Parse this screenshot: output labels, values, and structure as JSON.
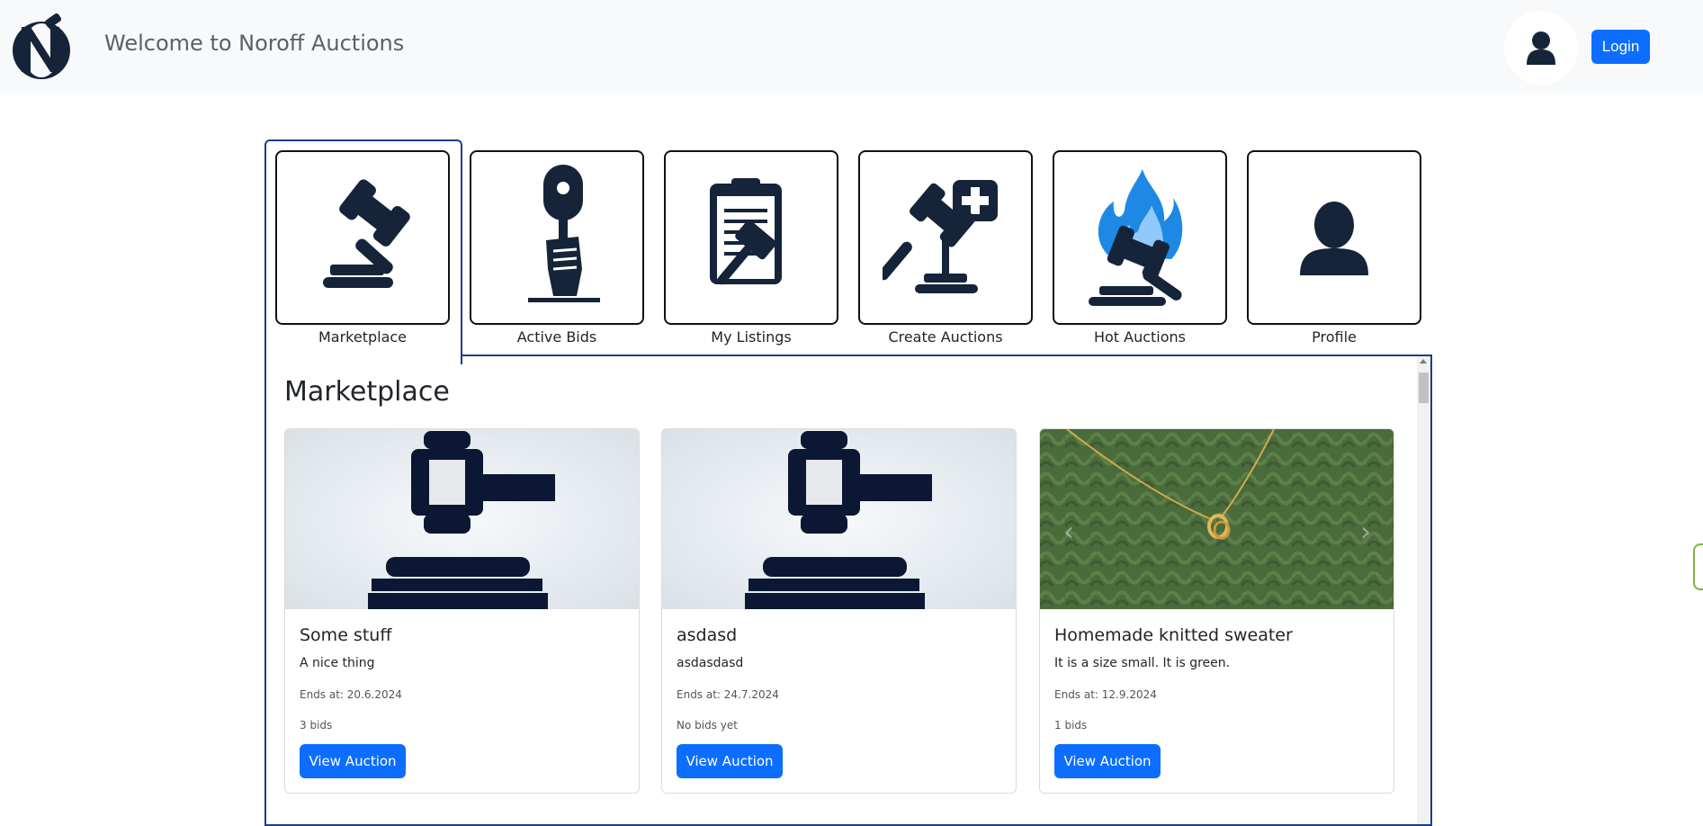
{
  "header": {
    "title": "Welcome to Noroff Auctions",
    "login_label": "Login",
    "logo_icon": "noroff-logo-icon",
    "avatar_icon": "user-icon"
  },
  "tabs": [
    {
      "label": "Marketplace",
      "icon": "gavel-icon",
      "active": true
    },
    {
      "label": "Active Bids",
      "icon": "bid-paddle-icon",
      "active": false
    },
    {
      "label": "My Listings",
      "icon": "clipboard-gavel-icon",
      "active": false
    },
    {
      "label": "Create Auctions",
      "icon": "gavel-plus-icon",
      "active": false
    },
    {
      "label": "Hot Auctions",
      "icon": "flaming-gavel-icon",
      "active": false
    },
    {
      "label": "Profile",
      "icon": "user-icon",
      "active": false
    }
  ],
  "main": {
    "heading": "Marketplace",
    "listings": [
      {
        "title": "Some stuff",
        "description": "A nice thing",
        "ends": "Ends at: 20.6.2024",
        "bids": "3 bids",
        "button": "View Auction",
        "image": "gavel-placeholder"
      },
      {
        "title": "asdasd",
        "description": "asdasdasd",
        "ends": "Ends at: 24.7.2024",
        "bids": "No bids yet",
        "button": "View Auction",
        "image": "gavel-placeholder"
      },
      {
        "title": "Homemade knitted sweater",
        "description": "It is a size small. It is green.",
        "ends": "Ends at: 12.9.2024",
        "bids": "1 bids",
        "button": "View Auction",
        "image": "green-knit-sweater-with-necklace"
      }
    ]
  },
  "colors": {
    "primary": "#0d6efd",
    "navy": "#16243a",
    "active_border": "#1a3c8f",
    "header_bg": "#f8f9fa",
    "sweater_green": "#4a6b3c",
    "flame_blue": "#1e88e5"
  }
}
